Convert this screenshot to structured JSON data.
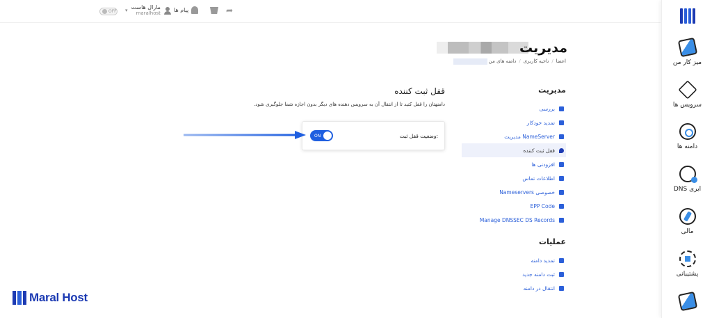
{
  "topbar": {
    "toggle_label": "OFF",
    "user_name": "مارال هاست",
    "user_sub": "maralhost",
    "messages_label": "پیام ها"
  },
  "sidebar": {
    "items": [
      {
        "label": "میز کار من",
        "icon": "dashboard-icon"
      },
      {
        "label": "سرویس ها",
        "icon": "services-icon"
      },
      {
        "label": "دامنه ها",
        "icon": "domains-icon"
      },
      {
        "label": "DNS ابری",
        "icon": "cloud-dns-icon"
      },
      {
        "label": "مالی",
        "icon": "finance-icon"
      },
      {
        "label": "پشتیبانی",
        "icon": "support-icon"
      }
    ]
  },
  "brand": {
    "name": "Maral Host"
  },
  "page": {
    "title": "مدیریت",
    "breadcrumb": [
      "اعضا",
      "ناحیه کاربری",
      "دامنه های من"
    ]
  },
  "manage": {
    "heading": "مدیریت",
    "items": [
      {
        "label": "بررسی",
        "icon": "overview-icon"
      },
      {
        "label": "تمدید خودکار",
        "icon": "autorenew-icon"
      },
      {
        "label": "مدیریت NameServer",
        "icon": "arrow-icon"
      },
      {
        "label": "قفل ثبت کننده",
        "icon": "shield-icon",
        "active": true
      },
      {
        "label": "افزودنی ها",
        "icon": "addons-icon"
      },
      {
        "label": "اطلاعات تماس",
        "icon": "contact-icon"
      },
      {
        "label": "Nameservers خصوصی",
        "icon": "arrow-icon"
      },
      {
        "label": "EPP Code",
        "icon": "gear-icon"
      },
      {
        "label": "Manage DNSSEC DS Records",
        "icon": "gear-icon"
      }
    ]
  },
  "actions": {
    "heading": "عملیات",
    "items": [
      {
        "label": "تمدید دامنه",
        "icon": "renew-icon"
      },
      {
        "label": "ثبت دامنه جدید",
        "icon": "register-icon"
      },
      {
        "label": "انتقال در دامنه",
        "icon": "transfer-icon"
      }
    ]
  },
  "content": {
    "title": "قفل ثبت کننده",
    "description": "دامنهتان را قفل کنید تا از انتقال آن به سرویس دهنده های دیگر بدون اجازه شما جلوگیری شود.",
    "lock_status_label": "وضعیت قفل ثبت:",
    "toggle_label": "ON"
  }
}
